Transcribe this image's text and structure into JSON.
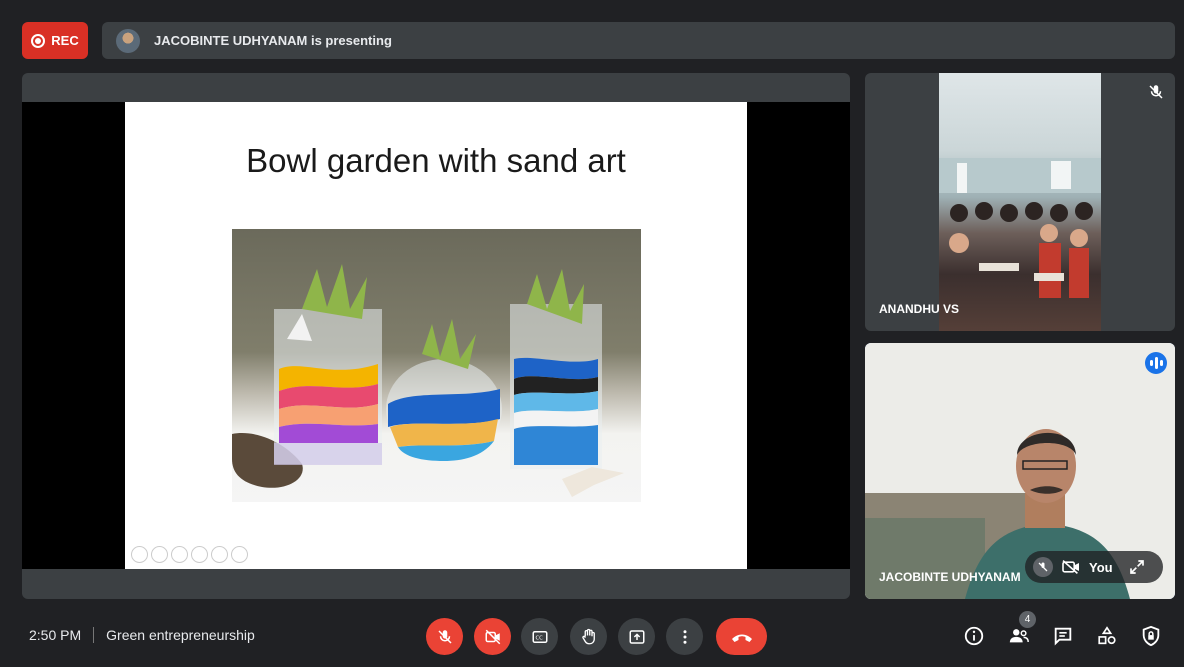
{
  "recording": {
    "label": "REC"
  },
  "presentation": {
    "banner": "JACOBINTE UDHYANAM is presenting"
  },
  "slide": {
    "title": "Bowl garden with sand art"
  },
  "participants": [
    {
      "name": "ANANDHU VS",
      "muted": true
    },
    {
      "name": "JACOBINTE UDHYANAM",
      "self_label": "You",
      "speaking": true
    }
  ],
  "meeting": {
    "time": "2:50 PM",
    "name": "Green entrepreneurship"
  },
  "people_count": "4",
  "colors": {
    "rec_red": "#d93025",
    "danger_red": "#ea4335",
    "active_blue": "#1a73e8",
    "panel": "#3c4043",
    "background": "#202124"
  },
  "icons": {
    "controls": [
      "mic-off-icon",
      "camera-off-icon",
      "captions-icon",
      "raise-hand-icon",
      "present-icon",
      "more-options-icon",
      "hang-up-icon"
    ],
    "right": [
      "info-icon",
      "people-icon",
      "chat-icon",
      "activities-icon",
      "host-controls-icon"
    ]
  }
}
